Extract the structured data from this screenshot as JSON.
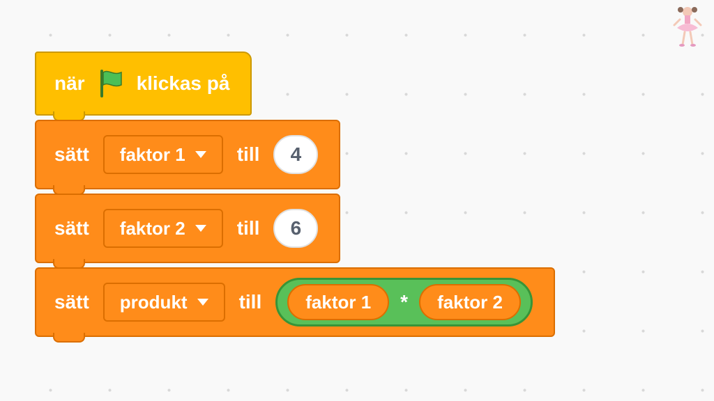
{
  "hat": {
    "prefix": "när",
    "suffix": "klickas på"
  },
  "blocks": [
    {
      "set_word": "sätt",
      "var": "faktor 1",
      "to_word": "till",
      "value": "4"
    },
    {
      "set_word": "sätt",
      "var": "faktor 2",
      "to_word": "till",
      "value": "6"
    },
    {
      "set_word": "sätt",
      "var": "produkt",
      "to_word": "till",
      "operator": {
        "left": "faktor 1",
        "sym": "*",
        "right": "faktor 2"
      }
    }
  ],
  "sprite_name": "ballerina"
}
